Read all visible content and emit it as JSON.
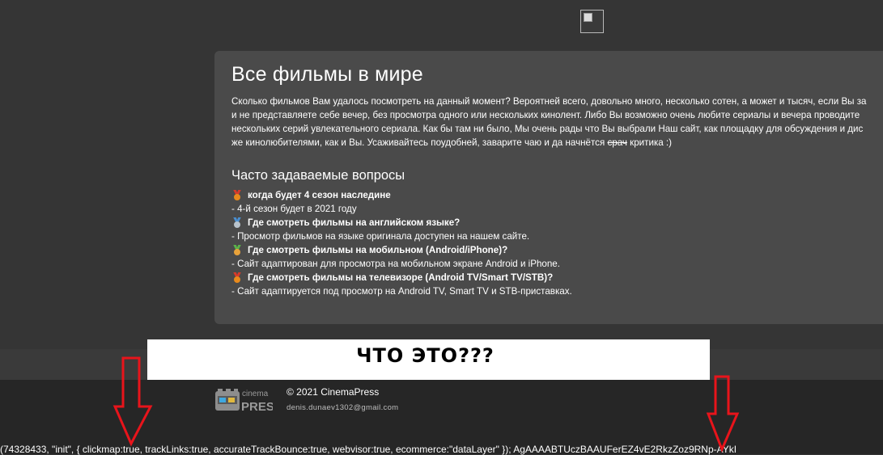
{
  "header": {
    "broken_image_icon": "broken-image-icon"
  },
  "card": {
    "title": "Все фильмы в мире",
    "intro_lines": [
      "Сколько фильмов Вам удалось посмотреть на данный момент? Вероятней всего, довольно много, несколько сотен, а может и тысяч, если Вы за",
      "и не представляете себе вечер, без просмотра одного или нескольких кинолент. Либо Вы возможно очень любите сериалы и вечера проводите",
      "нескольких серий увлекательного сериала. Как бы там ни было, Мы очень рады что Вы выбрали Наш сайт, как площадку для обсуждения и дис"
    ],
    "intro_last_before": "же кинолюбителями, как и Вы. Усаживайтесь поудобней, заварите чаю и да начнётся ",
    "intro_last_strike": "срач",
    "intro_last_after": " критика :)",
    "faq_title": "Часто задаваемые вопросы",
    "faq": [
      {
        "question": "когда будет 4 сезон наследине",
        "answer": "- 4-й сезон будет в 2021 году",
        "medal_color": "#e88a1c",
        "ribbon_color": "#d83b2a"
      },
      {
        "question": "Где смотреть фильмы на английском языке?",
        "answer": "- Просмотр фильмов на языке оригинала доступен на нашем сайте.",
        "medal_color": "#b9c3cc",
        "ribbon_color": "#4a8fd0"
      },
      {
        "question": "Где смотреть фильмы на мобильном (Android/iPhone)?",
        "answer": "- Сайт адаптирован для просмотра на мобильном экране Android и iPhone.",
        "medal_color": "#e8a23a",
        "ribbon_color": "#5bb34a"
      },
      {
        "question": "Где смотреть фильмы на телевизоре (Android TV/Smart TV/STB)?",
        "answer": "- Сайт адаптируется под просмотр на Android TV, Smart TV и STB-приставках.",
        "medal_color": "#e88a1c",
        "ribbon_color": "#d83b2a"
      }
    ]
  },
  "banner": {
    "text": "ЧТО  ЭТО???"
  },
  "footer": {
    "logo_word1": "cinema",
    "logo_word2": "PRESS",
    "copyright": "© 2021 CinemaPress",
    "email": "denis.dunaev1302@gmail.com"
  },
  "code_line": "(74328433, \"init\", { clickmap:true, trackLinks:true, accurateTrackBounce:true, webvisor:true, ecommerce:\"dataLayer\" }); AgAAAABTUczBAAUFerEZ4vE2RkzZoz9RNp-AYkI",
  "colors": {
    "page_bg": "#353535",
    "card_bg": "#4a4a4a",
    "footer_bg": "#262626",
    "arrow": "#e8141b"
  }
}
